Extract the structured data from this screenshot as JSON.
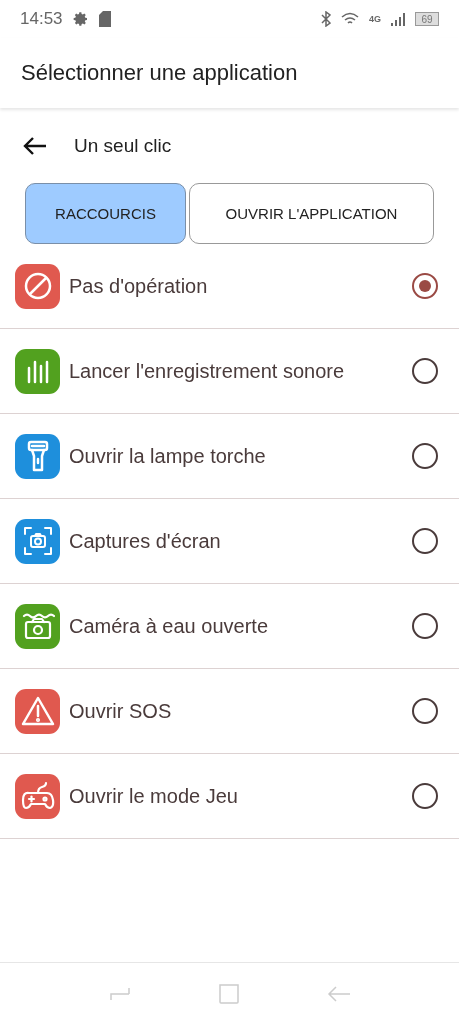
{
  "status_bar": {
    "time": "14:53",
    "network": "4G",
    "battery": "69"
  },
  "app_bar": {
    "title": "Sélectionner une application"
  },
  "subheader": {
    "title": "Un seul clic"
  },
  "tabs": [
    {
      "label": "RACCOURCIS",
      "selected": true
    },
    {
      "label": "OUVRIR L'APPLICATION",
      "selected": false
    }
  ],
  "options": [
    {
      "label": "Pas d'opération",
      "kind": "forbidden",
      "color": "#e0594f",
      "selected": true
    },
    {
      "label": "Lancer l'enregistrement sonore",
      "kind": "recorder",
      "color": "#52a11f",
      "selected": false
    },
    {
      "label": "Ouvrir la lampe torche",
      "kind": "torch",
      "color": "#1e8fdc",
      "selected": false
    },
    {
      "label": "Captures d'écran",
      "kind": "screenshot",
      "color": "#1e8fdc",
      "selected": false
    },
    {
      "label": "Caméra à eau ouverte",
      "kind": "watercamera",
      "color": "#52a11f",
      "selected": false
    },
    {
      "label": "Ouvrir SOS",
      "kind": "sos",
      "color": "#e0594f",
      "selected": false
    },
    {
      "label": "Ouvrir le mode Jeu",
      "kind": "game",
      "color": "#e0594f",
      "selected": false
    }
  ]
}
